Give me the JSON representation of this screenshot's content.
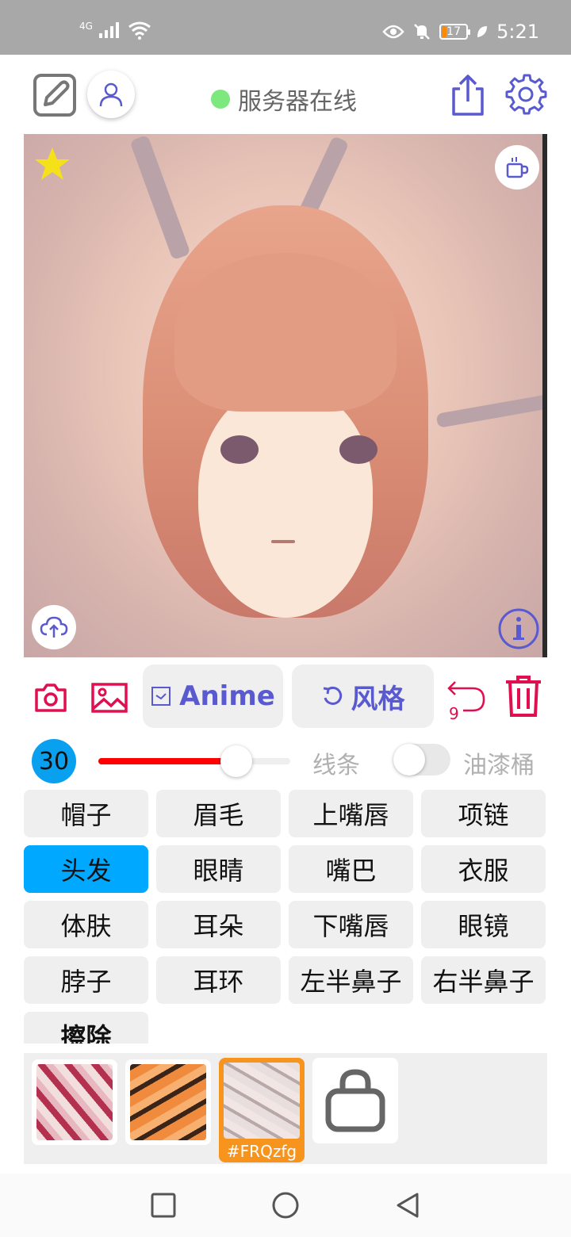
{
  "status_bar": {
    "network": "4G",
    "battery": "17",
    "time": "5:21"
  },
  "header": {
    "server_status": "服务器在线",
    "server_status_color": "#7de87d",
    "accent_color": "#5a5ad0"
  },
  "canvas": {
    "icons": [
      "star-icon",
      "coffee-cup-icon",
      "cloud-upload-icon",
      "info-icon"
    ]
  },
  "toolbar": {
    "anime_label": "Anime",
    "style_label": "风格",
    "undo_count": "9"
  },
  "brush": {
    "size": "30",
    "slider_level": 0.72,
    "line_label": "线条",
    "bucket_label": "油漆桶",
    "bucket_enabled": false
  },
  "tags": [
    {
      "label": "帽子"
    },
    {
      "label": "眉毛"
    },
    {
      "label": "上嘴唇"
    },
    {
      "label": "项链"
    },
    {
      "label": "头发",
      "active": true
    },
    {
      "label": "眼睛"
    },
    {
      "label": "嘴巴"
    },
    {
      "label": "衣服"
    },
    {
      "label": "体肤"
    },
    {
      "label": "耳朵"
    },
    {
      "label": "下嘴唇"
    },
    {
      "label": "眼镜"
    },
    {
      "label": "脖子"
    },
    {
      "label": "耳环"
    },
    {
      "label": "左半鼻子"
    },
    {
      "label": "右半鼻子"
    },
    {
      "label": "擦除"
    }
  ],
  "styles": {
    "selected_label": "#FRQzfg",
    "selected_color": "#f7941d"
  }
}
